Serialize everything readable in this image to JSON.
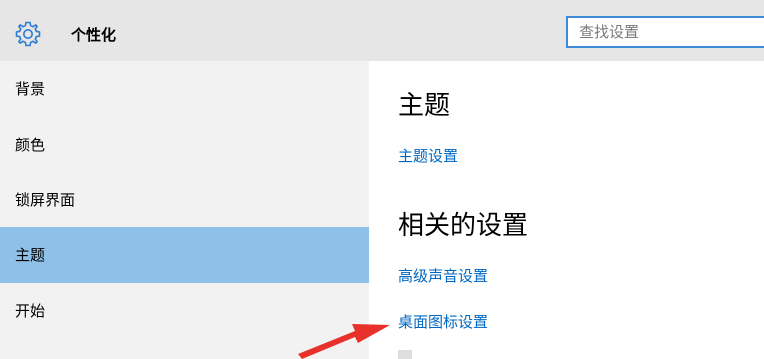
{
  "header": {
    "title": "个性化",
    "search_placeholder": "查找设置"
  },
  "sidebar": {
    "items": [
      {
        "label": "背景"
      },
      {
        "label": "颜色"
      },
      {
        "label": "锁屏界面"
      },
      {
        "label": "主题"
      },
      {
        "label": "开始"
      }
    ],
    "selected": "主题"
  },
  "main": {
    "theme_section": {
      "title": "主题",
      "link": "主题设置"
    },
    "related_section": {
      "title": "相关的设置",
      "links": [
        "高级声音设置",
        "桌面图标设置"
      ]
    }
  },
  "colors": {
    "accent": "#0067c0",
    "selected_bg": "#8fc1e8",
    "arrow": "#e8312a"
  },
  "icons": {
    "header_icon": "gear-icon",
    "annotation": "red-arrow"
  }
}
